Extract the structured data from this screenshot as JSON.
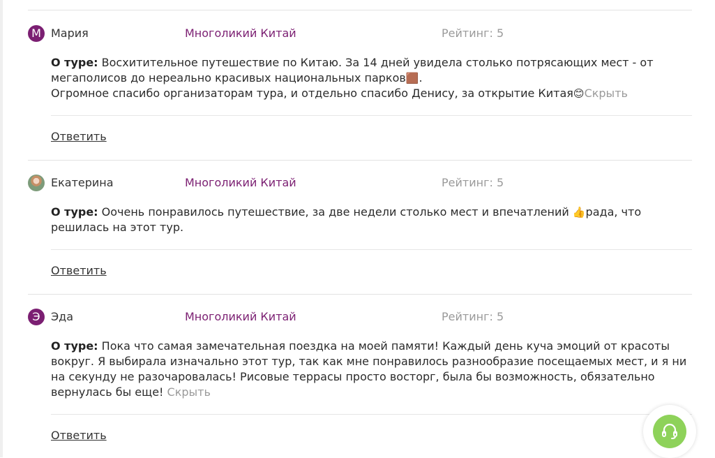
{
  "reviews": [
    {
      "avatar_letter": "М",
      "name": "Мария",
      "tour": "Многоликий Китай",
      "rating": "Рейтинг: 5",
      "about_label": "О туре:",
      "text_line1": " Восхитительное путешествие по Китаю. За 14 дней увидела столько потрясающих мест - от мегаполисов до нереально красивых национальных парков",
      "emoji1": "🟫",
      "text_line2": ".",
      "text_line3": "Огромное спасибо организаторам тура, и отдельно спасибо Денису, за открытие Китая",
      "emoji2": "😊",
      "hide_label": "Скрыть",
      "reply_label": "Ответить"
    },
    {
      "avatar_letter": "",
      "name": "Екатерина",
      "tour": "Многоликий Китай",
      "rating": "Рейтинг: 5",
      "about_label": "О туре:",
      "text_part1": " Оочень понравилось путешествие, за две недели столько мест и впечатлений ",
      "emoji": "👍",
      "text_part2": "рада, что решилась на этот тур.",
      "reply_label": "Ответить"
    },
    {
      "avatar_letter": "Э",
      "name": "Эда",
      "tour": "Многоликий Китай",
      "rating": "Рейтинг: 5",
      "about_label": "О туре:",
      "text": " Пока что самая замечательная поездка на моей памяти! Каждый день куча эмоций от красоты вокруг. Я выбирала изначально этот тур, так как мне понравилось разнообразие посещаемых мест, и я ни на секунду не разочаровалась! Рисовые террасы просто восторг, была бы возможность, обязательно вернулась бы еще! ",
      "hide_label": "Скрыть",
      "reply_label": "Ответить"
    }
  ],
  "support_button": {
    "icon": "headset-icon",
    "color": "#8ed25a"
  },
  "colors": {
    "accent": "#7b1f72",
    "muted": "#9a9a9a"
  }
}
